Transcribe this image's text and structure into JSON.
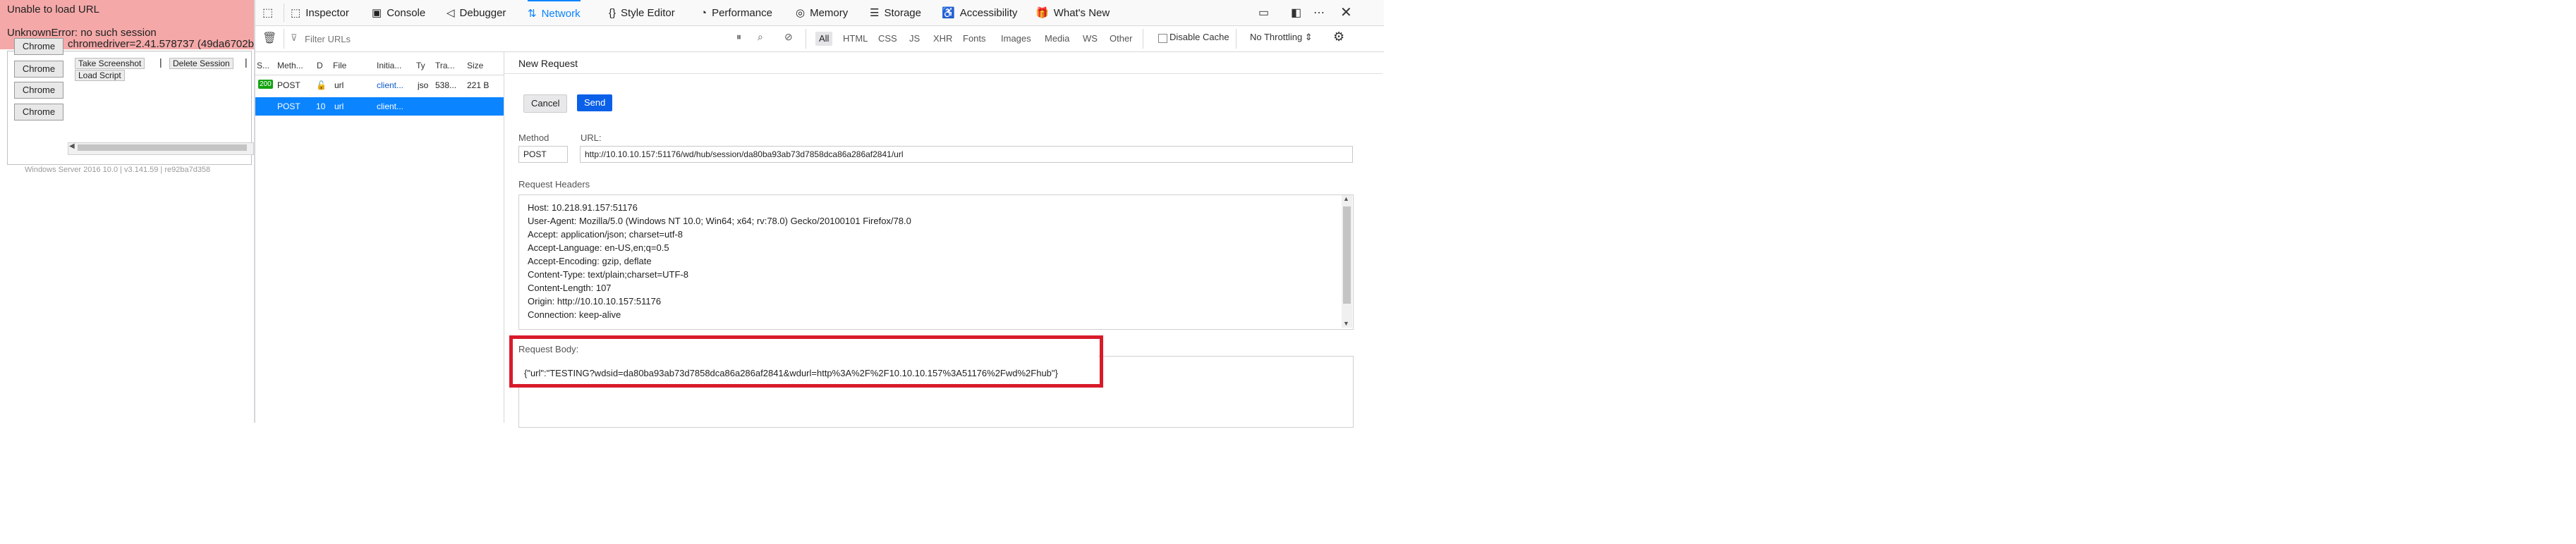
{
  "page": {
    "error_title": "Unable to load URL",
    "error_message_prefix": "UnknownError: no such session",
    "error_message_detail": "chromedriver=2.41.578737 (49da6702b",
    "chrome_buttons": [
      "Chrome",
      "Chrome",
      "Chrome",
      "Chrome"
    ],
    "session_actions": {
      "take_screenshot": "Take Screenshot",
      "delete_session": "Delete Session",
      "load_script": "Load Script"
    },
    "footer": "Windows Server 2016 10.0 | v3.141.59 | re92ba7d358"
  },
  "devtools": {
    "tabs": [
      {
        "label": "Inspector",
        "icon": "inspector-icon"
      },
      {
        "label": "Console",
        "icon": "console-icon"
      },
      {
        "label": "Debugger",
        "icon": "debugger-icon"
      },
      {
        "label": "Network",
        "icon": "network-icon"
      },
      {
        "label": "Style Editor",
        "icon": "style-editor-icon"
      },
      {
        "label": "Performance",
        "icon": "performance-icon"
      },
      {
        "label": "Memory",
        "icon": "memory-icon"
      },
      {
        "label": "Storage",
        "icon": "storage-icon"
      },
      {
        "label": "Accessibility",
        "icon": "accessibility-icon"
      },
      {
        "label": "What's New",
        "icon": "whats-new-icon"
      }
    ],
    "active_tab": "Network",
    "accent_color": "#0a84ff"
  },
  "network": {
    "filter_placeholder": "Filter URLs",
    "type_filters": [
      "All",
      "HTML",
      "CSS",
      "JS",
      "XHR",
      "Fonts",
      "Images",
      "Media",
      "WS",
      "Other"
    ],
    "selected_type": "All",
    "disable_cache_label": "Disable Cache",
    "throttling_label": "No Throttling ⇕",
    "columns": [
      "S...",
      "Meth...",
      "D",
      "File",
      "Initia...",
      "Ty",
      "Tra...",
      "Size"
    ],
    "requests": [
      {
        "status": "200",
        "method": "POST",
        "file": "url",
        "initiator": "client...",
        "type": "jso",
        "transferred": "538...",
        "size": "221 B"
      },
      {
        "status": "",
        "method": "POST",
        "domain": "10",
        "file": "url",
        "initiator": "client...",
        "type": "",
        "transferred": "",
        "size": ""
      }
    ]
  },
  "new_request": {
    "title": "New Request",
    "cancel_label": "Cancel",
    "send_label": "Send",
    "method_label": "Method",
    "url_label": "URL:",
    "method_value": "POST",
    "url_value": "http://10.10.10.157:51176/wd/hub/session/da80ba93ab73d7858dca86a286af2841/url",
    "headers_label": "Request Headers",
    "headers": [
      "Host: 10.218.91.157:51176",
      "User-Agent: Mozilla/5.0 (Windows NT 10.0; Win64; x64; rv:78.0) Gecko/20100101 Firefox/78.0",
      "Accept: application/json; charset=utf-8",
      "Accept-Language: en-US,en;q=0.5",
      "Accept-Encoding: gzip, deflate",
      "Content-Type: text/plain;charset=UTF-8",
      "Content-Length: 107",
      "Origin: http://10.10.10.157:51176",
      "Connection: keep-alive"
    ],
    "body_label": "Request Body:",
    "body_value": "{\"url\":\"TESTING?wdsid=da80ba93ab73d7858dca86a286af2841&wdurl=http%3A%2F%2F10.10.10.157%3A51176%2Fwd%2Fhub\"}",
    "highlight_color": "#d81b2a"
  }
}
